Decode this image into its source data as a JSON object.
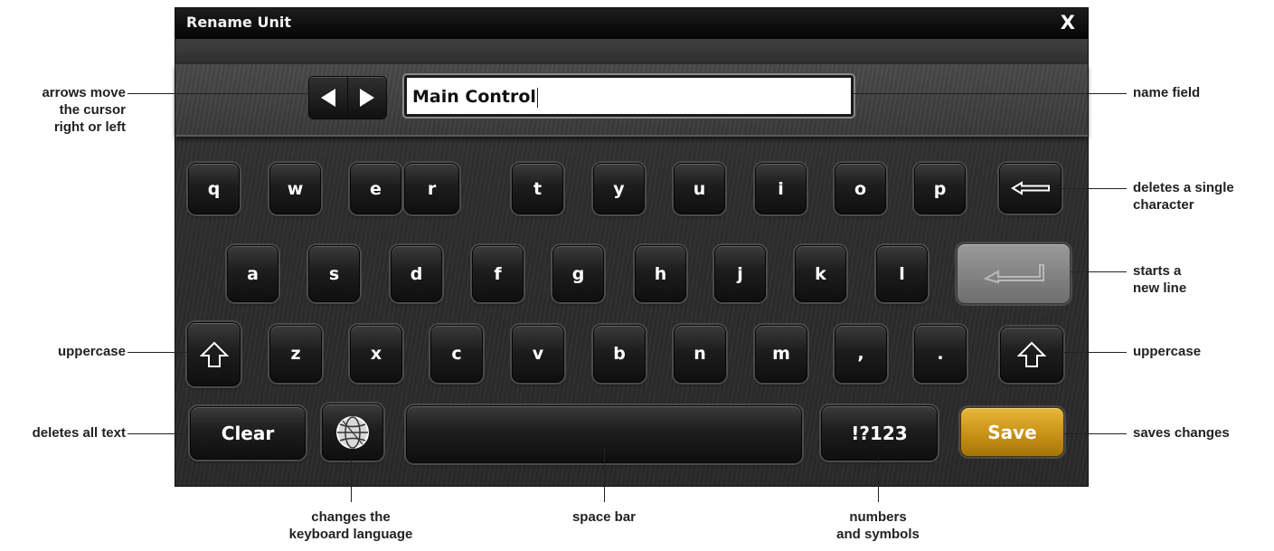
{
  "window": {
    "title": "Rename Unit",
    "close_label": "X"
  },
  "name_field": {
    "value": "Main Control"
  },
  "keyboard": {
    "row1": [
      "q",
      "w",
      "e",
      "r",
      "t",
      "y",
      "u",
      "i",
      "o",
      "p"
    ],
    "row2": [
      "a",
      "s",
      "d",
      "f",
      "g",
      "h",
      "j",
      "k",
      "l"
    ],
    "row3": [
      "z",
      "x",
      "c",
      "v",
      "b",
      "n",
      "m",
      ",",
      "."
    ],
    "clear_label": "Clear",
    "symbols_label": "!?123",
    "save_label": "Save",
    "save_color": "#d4a020"
  },
  "icons": {
    "cursor_left": "left-triangle-icon",
    "cursor_right": "right-triangle-icon",
    "backspace": "backspace-arrow-icon",
    "enter": "enter-return-icon",
    "shift": "shift-up-arrow-icon",
    "language": "globe-icon"
  },
  "annotations": {
    "arrows": "arrows move\nthe cursor\nright or left",
    "name_field": "name field",
    "backspace": "deletes a single\ncharacter",
    "enter": "starts a\nnew line",
    "shift_left": "uppercase",
    "shift_right": "uppercase",
    "clear": "deletes all text",
    "save": "saves changes",
    "language": "changes the\nkeyboard language",
    "space": "space bar",
    "symbols": "numbers\nand symbols"
  }
}
